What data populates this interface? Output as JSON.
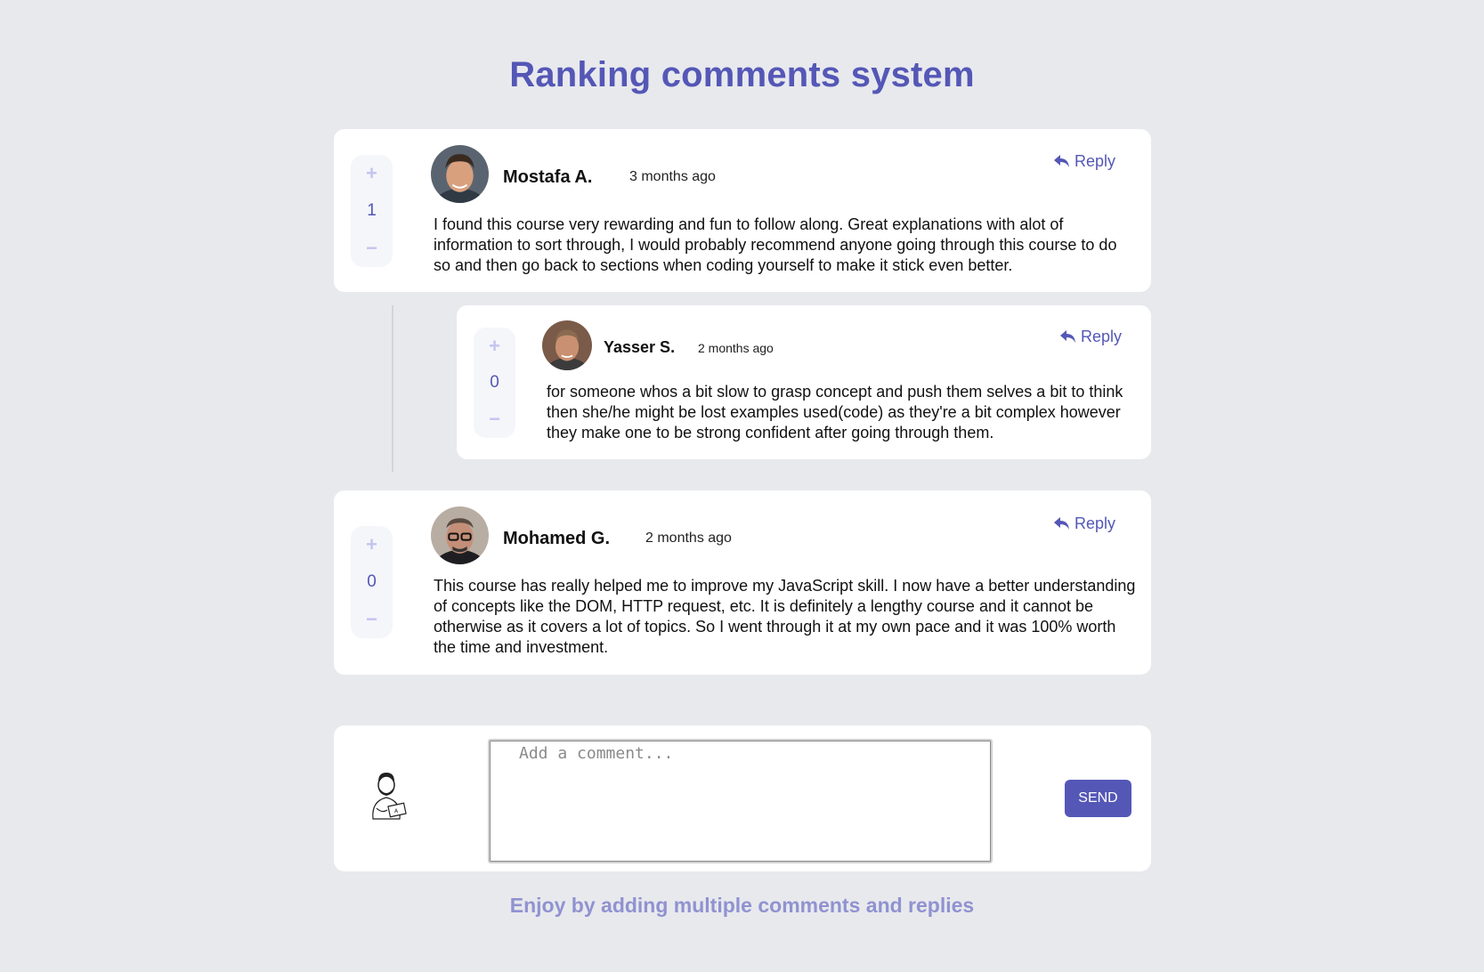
{
  "page": {
    "title": "Ranking comments system",
    "footer": "Enjoy by adding multiple comments and replies"
  },
  "comments": [
    {
      "author": "Mostafa A.",
      "time": "3 months ago",
      "score": "1",
      "reply_label": "Reply",
      "text": "I found this course very rewarding and fun to follow along. Great explanations with alot of information to sort through, I would probably recommend anyone going through this course to do so and then go back to sections when coding yourself to make it stick even better.",
      "replies": [
        {
          "author": "Yasser S.",
          "time": "2 months ago",
          "score": "0",
          "reply_label": "Reply",
          "text": "for someone whos a bit slow to grasp concept and push them selves a bit to think then she/he might be lost examples used(code) as they're a bit complex however they make one to be strong confident after going through them."
        }
      ]
    },
    {
      "author": "Mohamed G.",
      "time": "2 months ago",
      "score": "0",
      "reply_label": "Reply",
      "text": "This course has really helped me to improve my JavaScript skill. I now have a better understanding of concepts like the DOM, HTTP request, etc. It is definitely a lengthy course and it cannot be otherwise as it covers a lot of topics. So I went through it at my own pace and it was 100% worth the time and investment.",
      "replies": []
    }
  ],
  "composer": {
    "placeholder": "Add a comment...",
    "send_label": "SEND"
  },
  "icons": {
    "upvote": "plus-icon",
    "downvote": "minus-icon",
    "reply": "reply-arrow-icon"
  },
  "colors": {
    "accent": "#5457b6",
    "background": "#e8e9ed",
    "vote_bg": "#f5f6fa",
    "muted_accent": "#c3c4ef",
    "footer": "#9092d0"
  }
}
